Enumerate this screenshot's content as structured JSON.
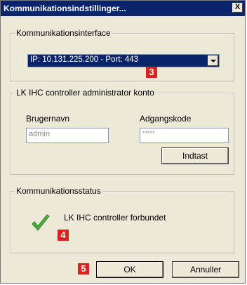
{
  "window": {
    "title": "Kommunikationsindstillinger...",
    "close": "X"
  },
  "interface": {
    "legend": "Kommunikationsinterface",
    "selected": "IP: 10.131.225.200 - Port: 443",
    "badge": "3"
  },
  "account": {
    "legend": "LK IHC controller administrator konto",
    "username_label": "Brugernavn",
    "username_value": "admin",
    "password_label": "Adgangskode",
    "password_value": "*****",
    "submit_label": "Indtast"
  },
  "status": {
    "legend": "Kommunikationsstatus",
    "message": "LK IHC controller forbundet",
    "badge": "4",
    "icon": "checkmark-icon"
  },
  "footer": {
    "badge": "5",
    "ok_label": "OK",
    "cancel_label": "Annuller"
  },
  "colors": {
    "title_bar": "#0a246a",
    "dialog_bg": "#ece9d8",
    "badge_red": "#e0201c",
    "check_green": "#4caf3a"
  }
}
